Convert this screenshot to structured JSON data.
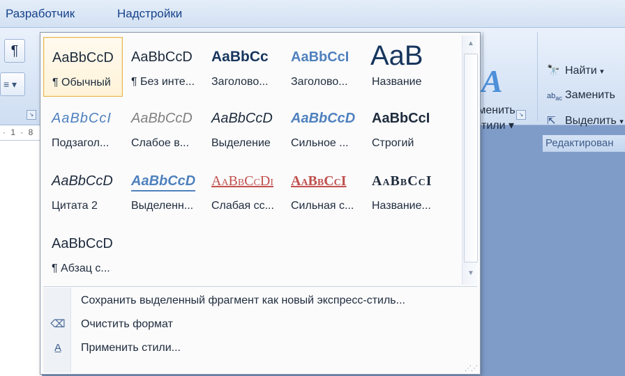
{
  "tabs": {
    "developer": "Разработчик",
    "addins": "Надстройки"
  },
  "ribbon": {
    "paragraph_mark": "¶",
    "change_styles": {
      "line1": "зменить",
      "line2": "тили",
      "icon": "styles-a-icon"
    },
    "editing": {
      "find": "Найти",
      "replace": "Заменить",
      "select": "Выделить",
      "group_label": "Редактирован"
    }
  },
  "ruler": {
    "text": "· 1 · 8 ·"
  },
  "gallery": {
    "styles": [
      {
        "sample": "AaBbCcD",
        "name": "¶ Обычный"
      },
      {
        "sample": "AaBbCcD",
        "name": "¶ Без инте..."
      },
      {
        "sample": "AaBbCc",
        "name": "Заголово..."
      },
      {
        "sample": "AaBbCcI",
        "name": "Заголово..."
      },
      {
        "sample": "AaB",
        "name": "Название"
      },
      {
        "sample": "AaBbCcI",
        "name": "Подзагол..."
      },
      {
        "sample": "AaBbCcD",
        "name": "Слабое в..."
      },
      {
        "sample": "AaBbCcD",
        "name": "Выделение"
      },
      {
        "sample": "AaBbCcD",
        "name": "Сильное ..."
      },
      {
        "sample": "AaBbCcI",
        "name": "Строгий"
      },
      {
        "sample": "AaBbCcD",
        "name": "Цитата 2"
      },
      {
        "sample": "AaBbCcD",
        "name": "Выделенн..."
      },
      {
        "sample": "AaBbCcDi",
        "name": "Слабая сс..."
      },
      {
        "sample": "AaBbCcI",
        "name": "Сильная с..."
      },
      {
        "sample": "AaBbCcI",
        "name": "Название..."
      },
      {
        "sample": "AaBbCcD",
        "name": "¶ Абзац с..."
      }
    ],
    "selected_index": 0,
    "menu": {
      "save": "Сохранить выделенный фрагмент как новый экспресс-стиль...",
      "clear": "Очистить формат",
      "apply": "Применить стили..."
    }
  },
  "colors": {
    "accent": "#4f81bd",
    "heading": "#17365d",
    "reference": "#c0504d",
    "selection_border": "#e6b55a"
  }
}
